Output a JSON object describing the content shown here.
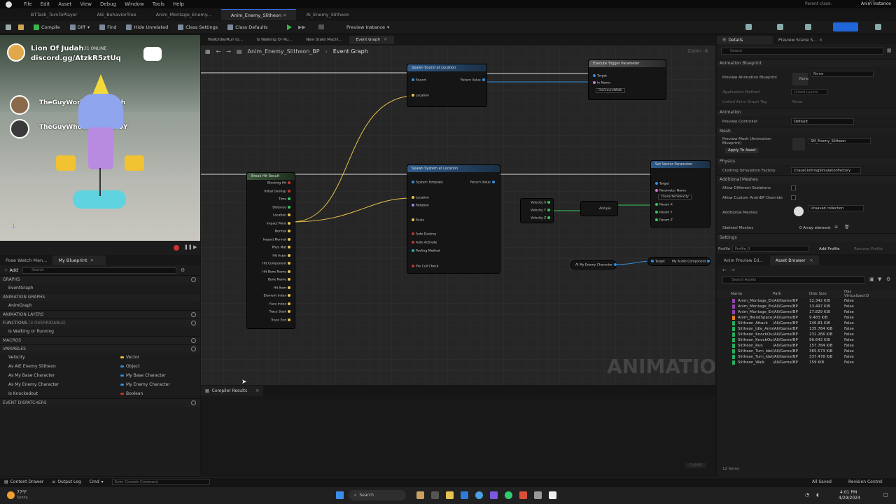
{
  "window": {
    "menu": [
      "File",
      "Edit",
      "Asset",
      "View",
      "Debug",
      "Window",
      "Tools",
      "Help"
    ],
    "doc_tabs": [
      "BTTask_TurnToPlayer",
      "AIE_BehaviorTree",
      "Anim_Montage_Enemy...",
      "Anim_Enemy_Slitheon",
      "AI_Enemy_Slitheon"
    ],
    "active_doc_index": 3,
    "parent_class_label": "Parent class:",
    "parent_class_value": "Anim Instance"
  },
  "toolbar": {
    "compile": "Compile",
    "diff": "Diff",
    "find": "Find",
    "hide_unrelated": "Hide Unrelated",
    "class_settings": "Class Settings",
    "class_defaults": "Class Defaults",
    "preview_instance": "Preview Instance"
  },
  "webcam": {
    "streamer": "Lion Of Judah",
    "online": "21 ONLINE",
    "discord": "discord.gg/AtzkR5ztUq",
    "user1": "TheGuyWorkingOnJudah",
    "user2": "TheGuyWhoWorksOnFOY"
  },
  "graph_tabs": {
    "tab1": "Walk/Idle/Run to...",
    "tab2": "Is Walking Or Ru...",
    "tab3": "New State Machi...",
    "tab4": "Event Graph",
    "breadcrumb_root": "Anim_Enemy_Slitheon_BP",
    "breadcrumb_current": "Event Graph",
    "zoom": "Zoom -4"
  },
  "graph": {
    "watermark": "ANIMATION",
    "nodes": {
      "sound_title": "Spawn Sound at Location",
      "sound_pins": [
        "Sound",
        "Location",
        "Return Value"
      ],
      "trigger_title": "Execute Trigger Parameter",
      "trigger_pins": [
        "Target",
        "In Name",
        "OnGroundWalk"
      ],
      "break_title": "Break Hit Result",
      "break_pins": [
        "Blocking Hit",
        "Initial Overlap",
        "Time",
        "Distance",
        "Location",
        "Impact Point",
        "Normal",
        "Impact Normal",
        "Phys Mat",
        "Hit Actor",
        "Hit Component",
        "Hit Bone Name",
        "Bone Name",
        "Hit Item",
        "Element Index",
        "Face Index",
        "Trace Start",
        "Trace End"
      ],
      "system_title": "Spawn System at Location",
      "system_pins": [
        "System Template",
        "Location",
        "Rotation",
        "Scale",
        "Auto Destroy",
        "Auto Activate",
        "Pooling Method",
        "Pre Cull Check",
        "Return Value"
      ],
      "vector_title": "Set Vector Parameter",
      "vector_pins": [
        "Target",
        "Parameter Name",
        "CharacterVelocity",
        "Param X",
        "Param Y",
        "Param Z"
      ],
      "velocity_pins": [
        "Velocity X",
        "Velocity Y",
        "Velocity Z"
      ],
      "add_label": "Add pin",
      "enemy_char": "AI My Enemy Character",
      "target_label": "Target",
      "audio_comp": "My Audio Component"
    }
  },
  "left_panel": {
    "tab1": "Pose Watch Man...",
    "tab2": "My Blueprint",
    "add": "Add",
    "search_placeholder": "Search",
    "graphs": "GRAPHS",
    "event_graph": "EventGraph",
    "anim_graphs": "ANIMATION GRAPHS",
    "anim_graph": "AnimGraph",
    "anim_layers": "ANIMATION LAYERS",
    "functions": "FUNCTIONS",
    "functions_override": "(3 OVERRIDABLE)",
    "func1": "Is Walking or Running",
    "macros": "MACROS",
    "variables": "VARIABLES",
    "vars": [
      {
        "name": "Velocity",
        "type": "Vector",
        "color": "#f2c230"
      },
      {
        "name": "As AIE Enemy Slitheon",
        "type": "Object",
        "color": "#2f8ee0"
      },
      {
        "name": "As My Base Character",
        "type": "My Base Character",
        "color": "#2f8ee0"
      },
      {
        "name": "As My Enemy Character",
        "type": "My Enemy Character",
        "color": "#2f8ee0"
      },
      {
        "name": "Is Knockedout",
        "type": "Boolean",
        "color": "#c0392b"
      }
    ],
    "dispatchers": "EVENT DISPATCHERS"
  },
  "compiler": {
    "tab": "Compiler Results",
    "clear": "CLEAR"
  },
  "details": {
    "tab1": "Details",
    "tab2": "Preview Scene S...",
    "search_placeholder": "Search",
    "anim_blueprint": "Animation Blueprint",
    "preview_anim_bp": "Preview Animation Blueprint",
    "none": "None",
    "app_method": "Application Method",
    "linked_layers": "Linked Layers",
    "linked_anim_tag": "Linked Anim Graph Tag",
    "animation": "Animation",
    "preview_controller": "Preview Controller",
    "default": "Default",
    "mesh": "Mesh",
    "preview_mesh": "Preview Mesh (Animation Blueprint)",
    "apply_to_asset": "Apply To Asset",
    "mesh_value": "SM_Enemy_Slitheon",
    "physics": "Physics",
    "clothing": "Clothing Simulation Factory",
    "clothing_value": "ChaosClothingSimulationFactory",
    "additional_meshes": "Additional Meshes",
    "allow_diff": "Allow Different Skeletons",
    "allow_custom": "Allow Custom AnimBP Override",
    "additional_meshes2": "Additional Meshes",
    "unsaved": "Unsaved collection",
    "skeletal_meshes": "Skeletal Meshes",
    "array_elem": "0 Array element",
    "settings": "Settings",
    "profile": "Profile",
    "profile_value": "Profile_0",
    "add_profile": "Add Profile",
    "remove_profile": "Remove Profile"
  },
  "asset_browser": {
    "tab1": "Anim Preview Ed...",
    "tab2": "Asset Browser",
    "search_placeholder": "Search Assets",
    "columns": [
      "Name",
      "Path",
      "Disk Size",
      "Has Virtualized D"
    ],
    "rows": [
      {
        "name": "Anim_Montage_Enemy_S",
        "path": "/All/Game/BP",
        "size": "12.342 KiB",
        "virt": "False",
        "color": "#8e44ad"
      },
      {
        "name": "Anim_Montage_Enemy_S",
        "path": "/All/Game/BP",
        "size": "13.497 KiB",
        "virt": "False",
        "color": "#8e44ad"
      },
      {
        "name": "Anim_Montage_Enemy_S",
        "path": "/All/Game/BP",
        "size": "17.829 KiB",
        "virt": "False",
        "color": "#8e44ad"
      },
      {
        "name": "Anim_BlendSpace_Walkin",
        "path": "/All/Game/BP",
        "size": "9.483 KiB",
        "virt": "False",
        "color": "#e67e22"
      },
      {
        "name": "Slitheon_Attack",
        "path": "/All/Game/BP",
        "size": "146.81 KiB",
        "virt": "False",
        "color": "#27ae60"
      },
      {
        "name": "Slitheon_Idle_Anim",
        "path": "/All/Game/BP",
        "size": "135.784 KiB",
        "virt": "False",
        "color": "#27ae60"
      },
      {
        "name": "Slitheon_KnockOut",
        "path": "/All/Game/BP",
        "size": "231.266 KiB",
        "virt": "False",
        "color": "#27ae60"
      },
      {
        "name": "Slitheon_KnockOut_Idle",
        "path": "/All/Game/BP",
        "size": "96.642 KiB",
        "virt": "False",
        "color": "#27ae60"
      },
      {
        "name": "Slitheon_Run",
        "path": "/All/Game/BP",
        "size": "157.784 KiB",
        "virt": "False",
        "color": "#27ae60"
      },
      {
        "name": "Slitheon_Turn_Idel_Left",
        "path": "/All/Game/BP",
        "size": "365.573 KiB",
        "virt": "False",
        "color": "#27ae60"
      },
      {
        "name": "Slitheon_Turn_Idel_Right",
        "path": "/All/Game/BP",
        "size": "337.478 KiB",
        "virt": "False",
        "color": "#27ae60"
      },
      {
        "name": "Slitheon_Walk",
        "path": "/All/Game/BP",
        "size": "159 KiB",
        "virt": "False",
        "color": "#27ae60"
      }
    ],
    "count": "12 items"
  },
  "status": {
    "content_drawer": "Content Drawer",
    "output_log": "Output Log",
    "cmd": "Cmd",
    "console_placeholder": "Enter Console Command",
    "all_saved": "All Saved",
    "revision": "Revision Control"
  },
  "taskbar": {
    "search": "Search",
    "weather": "77°F",
    "weather_sub": "Sunny",
    "time": "4:01 PM",
    "date": "4/29/2024"
  }
}
